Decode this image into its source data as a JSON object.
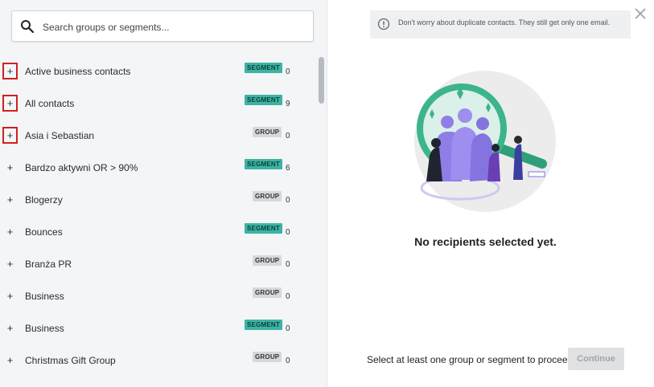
{
  "search": {
    "placeholder": "Search groups or segments..."
  },
  "info": {
    "text": "Don't worry about duplicate contacts. They still get only one email."
  },
  "list": {
    "items": [
      {
        "name": "Active business contacts",
        "type": "SEGMENT",
        "count": "0",
        "highlight": true
      },
      {
        "name": "All contacts",
        "type": "SEGMENT",
        "count": "9",
        "highlight": true
      },
      {
        "name": "Asia i Sebastian",
        "type": "GROUP",
        "count": "0",
        "highlight": true
      },
      {
        "name": "Bardzo aktywni OR > 90%",
        "type": "SEGMENT",
        "count": "6",
        "highlight": false
      },
      {
        "name": "Blogerzy",
        "type": "GROUP",
        "count": "0",
        "highlight": false
      },
      {
        "name": "Bounces",
        "type": "SEGMENT",
        "count": "0",
        "highlight": false
      },
      {
        "name": "Branża PR",
        "type": "GROUP",
        "count": "0",
        "highlight": false
      },
      {
        "name": "Business",
        "type": "GROUP",
        "count": "0",
        "highlight": false
      },
      {
        "name": "Business",
        "type": "SEGMENT",
        "count": "0",
        "highlight": false
      },
      {
        "name": "Christmas Gift Group",
        "type": "GROUP",
        "count": "0",
        "highlight": false
      }
    ],
    "plus_symbol": "+"
  },
  "empty_state": {
    "title": "No recipients selected yet."
  },
  "footer": {
    "hint": "Select at least one group or segment to proceed.",
    "continue_label": "Continue"
  },
  "colors": {
    "segment_badge": "#3cb4a4",
    "group_badge": "#d6d8db",
    "highlight_border": "#d0201f",
    "illustration_accent": "#3cb48c",
    "illustration_people": "#8f7ee8"
  },
  "icons": {
    "search": "search-icon",
    "info": "info-icon",
    "close": "close-icon",
    "expand": "plus-icon"
  }
}
